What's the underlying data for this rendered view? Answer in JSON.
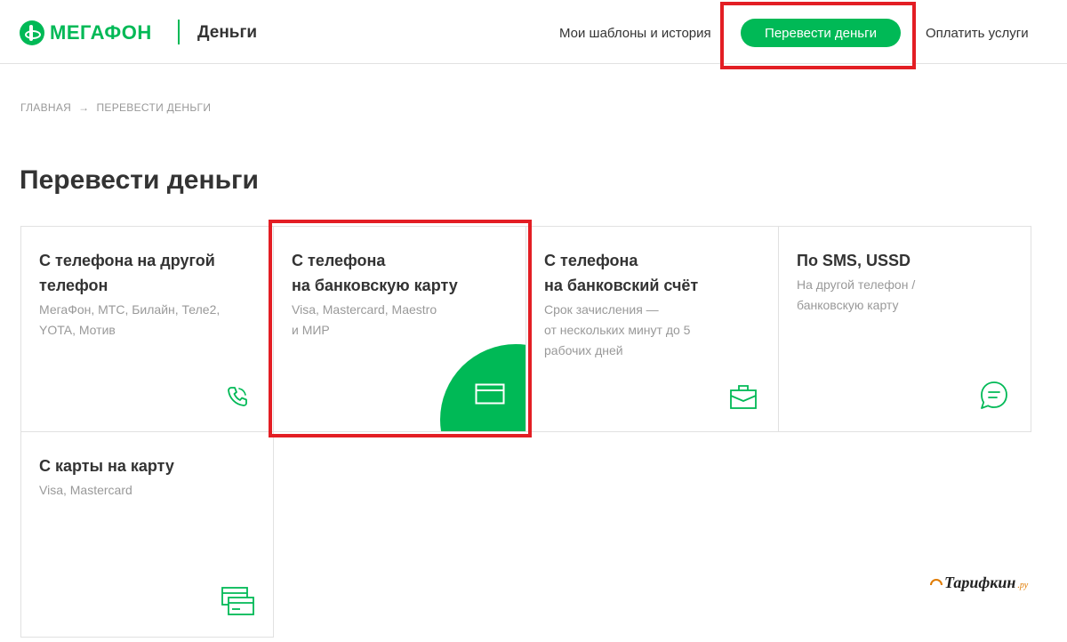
{
  "header": {
    "logo_text": "МЕГАФОН",
    "section_title": "Деньги",
    "nav_templates": "Мои шаблоны и история",
    "nav_transfer": "Перевести деньги",
    "nav_pay": "Оплатить услуги"
  },
  "breadcrumb": {
    "home": "ГЛАВНАЯ",
    "arrow": "→",
    "current": "ПЕРЕВЕСТИ ДЕНЬГИ"
  },
  "page_title": "Перевести деньги",
  "cards": [
    {
      "title": "С телефона на другой\nтелефон",
      "subtitle": "МегаФон, МТС, Билайн, Теле2,\nYOTA, Мотив",
      "icon": "phone-icon"
    },
    {
      "title": "С телефона\nна банковскую карту",
      "subtitle": "Visa, Mastercard, Maestro\nи МИР",
      "icon": "card-icon"
    },
    {
      "title": "С телефона\nна банковский счёт",
      "subtitle": "Срок зачисления —\nот нескольких минут до 5\nрабочих дней",
      "icon": "briefcase-icon"
    },
    {
      "title": "По SMS, USSD",
      "subtitle": "На другой телефон /\nбанковскую карту",
      "icon": "chat-bubble-icon"
    },
    {
      "title": "С карты на карту",
      "subtitle": "Visa, Mastercard",
      "icon": "two-cards-icon"
    }
  ],
  "watermark": {
    "text": "Тарифкин",
    "suffix": ".ру"
  },
  "colors": {
    "brand_green": "#00b956",
    "highlight_red": "#e31e24",
    "text_dark": "#333333",
    "text_muted": "#999999",
    "border": "#e1e1e1"
  }
}
